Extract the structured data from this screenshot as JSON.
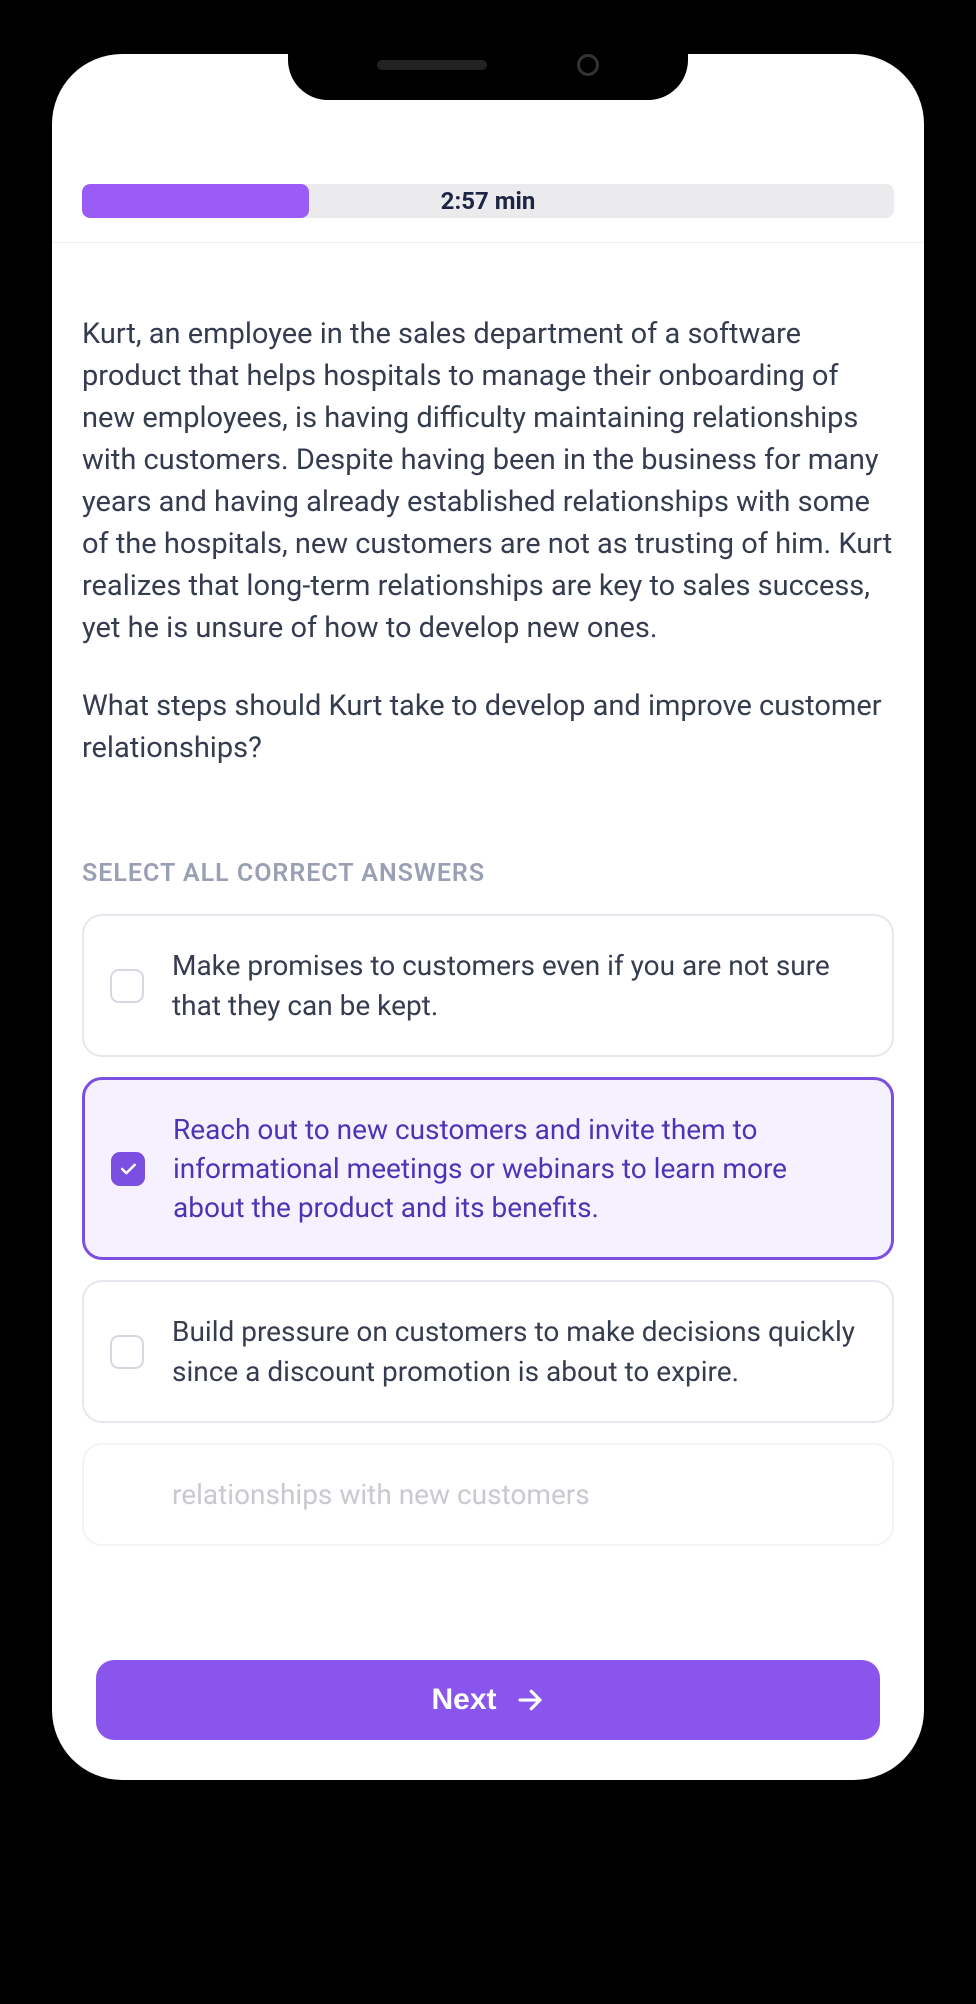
{
  "progress": {
    "fill_percent": 28,
    "time_label": "2:57 min"
  },
  "scenario_text": "Kurt, an employee in the sales department of a software product that helps hospitals to manage their onboarding of new employees, is having difficulty maintaining relationships with customers. Despite having been in the business for many years and having already established relationships with some of the hospitals, new customers are not as trusting of him. Kurt realizes that long-term relationships are key to sales success, yet he is unsure of how to develop new ones.",
  "question_text": "What steps should Kurt take to develop and improve customer relationships?",
  "instruction_label": "SELECT ALL CORRECT ANSWERS",
  "options": [
    {
      "text": "Make promises to customers even if you are not sure that they can be kept.",
      "selected": false
    },
    {
      "text": "Reach out to new customers and invite them to informational meetings or webinars to learn more about the product and its benefits.",
      "selected": true
    },
    {
      "text": "Build pressure on customers to make decisions quickly since a discount promotion is about to expire.",
      "selected": false
    },
    {
      "text": "relationships with new customers",
      "selected": false
    }
  ],
  "next_label": "Next"
}
